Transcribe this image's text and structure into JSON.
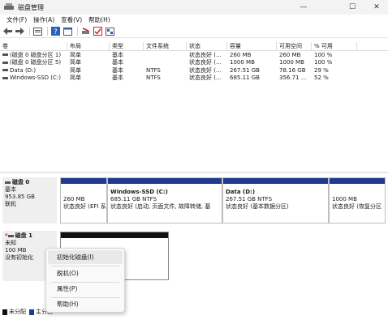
{
  "window": {
    "title": "磁盘管理",
    "controls": {
      "minimize": "—",
      "maximize": "☐",
      "close": "✕"
    }
  },
  "menu": [
    "文件(F)",
    "操作(A)",
    "查看(V)",
    "帮助(H)"
  ],
  "toolbar": {
    "icons": [
      "back-icon",
      "forward-icon",
      "properties-icon",
      "help-icon",
      "console-icon",
      "rescan-icon",
      "check-icon",
      "settings-icon"
    ]
  },
  "volumes": {
    "headers": [
      "卷",
      "布局",
      "类型",
      "文件系统",
      "状态",
      "容量",
      "可用空间",
      "% 可用"
    ],
    "rows": [
      [
        "(磁盘 0 磁盘分区 1)",
        "简单",
        "基本",
        "",
        "状态良好 (...",
        "260 MB",
        "260 MB",
        "100 %"
      ],
      [
        "(磁盘 0 磁盘分区 5)",
        "简单",
        "基本",
        "",
        "状态良好 (...",
        "1000 MB",
        "1000 MB",
        "100 %"
      ],
      [
        "Data (D:)",
        "简单",
        "基本",
        "NTFS",
        "状态良好 (...",
        "267.51 GB",
        "78.16 GB",
        "29 %"
      ],
      [
        "Windows-SSD (C:)",
        "简单",
        "基本",
        "NTFS",
        "状态良好 (...",
        "685.11 GB",
        "356.71 ...",
        "52 %"
      ]
    ]
  },
  "disks": [
    {
      "name": "磁盘 0",
      "type": "基本",
      "size": "953.85 GB",
      "state": "联机",
      "partitions": [
        {
          "name": "",
          "size": "260 MB",
          "status": "状态良好 (EFI 系"
        },
        {
          "name": "Windows-SSD  (C:)",
          "size": "685.11 GB NTFS",
          "status": "状态良好 (启动, 页面文件, 故障转储, 基"
        },
        {
          "name": "Data  (D:)",
          "size": "267.51 GB NTFS",
          "status": "状态良好 (基本数据分区)"
        },
        {
          "name": "",
          "size": "1000 MB",
          "status": "状态良好 (恢复分区"
        }
      ]
    },
    {
      "name": "磁盘 1",
      "type": "未知",
      "size": "100 MB",
      "state": "没有初始化"
    }
  ],
  "context_menu": {
    "items": [
      "初始化磁盘(I)",
      "脱机(O)",
      "属性(P)",
      "帮助(H)"
    ]
  },
  "legend": {
    "items": [
      {
        "label": "未分配",
        "color": "#111111"
      },
      {
        "label": "主分区",
        "color": "#1f3a8f"
      }
    ]
  },
  "colors": {
    "primary_partition": "#1f3a8f",
    "unallocated": "#111111"
  }
}
